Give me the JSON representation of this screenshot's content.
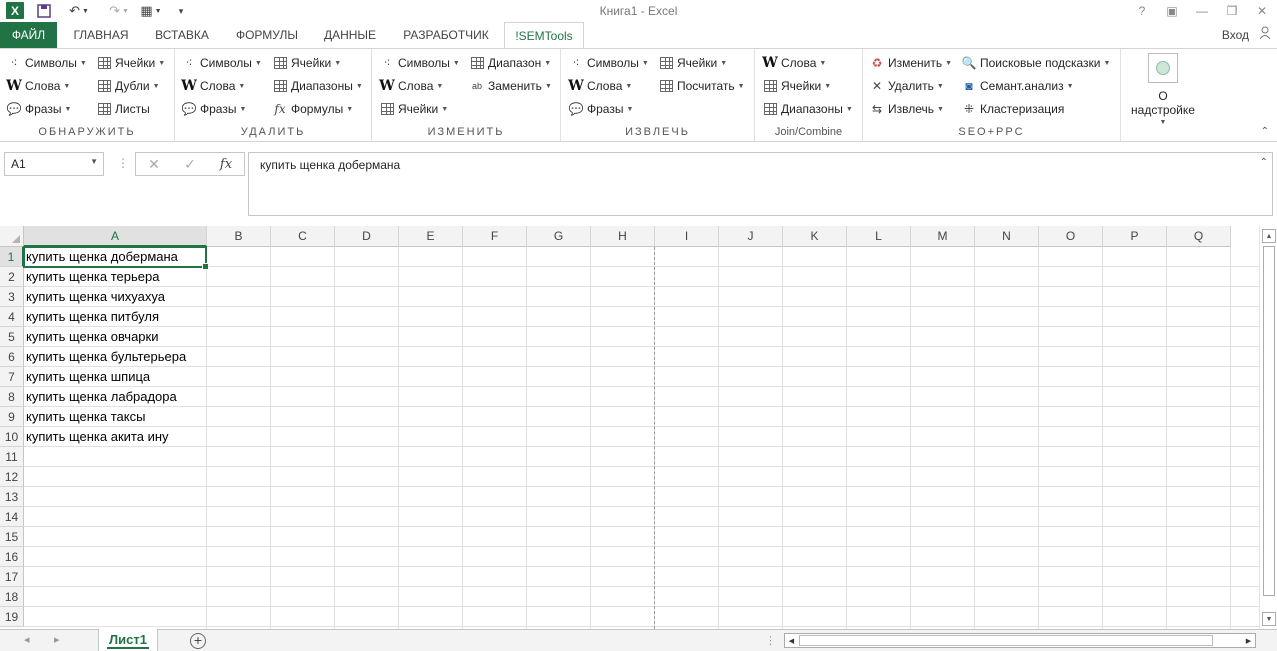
{
  "window": {
    "title": "Книга1 - Excel",
    "logo": "X"
  },
  "tabs": {
    "file": "ФАЙЛ",
    "items": [
      "ГЛАВНАЯ",
      "ВСТАВКА",
      "ФОРМУЛЫ",
      "ДАННЫЕ",
      "РАЗРАБОТЧИК",
      "!SEMTools"
    ],
    "active": "!SEMTools",
    "signin": "Вход"
  },
  "ribbon": {
    "discover": {
      "label": "ОБНАРУЖИТЬ",
      "symbols": "Символы",
      "words": "Слова",
      "phrases": "Фразы",
      "cells": "Ячейки",
      "dupes": "Дубли",
      "sheets": "Листы"
    },
    "remove": {
      "label": "УДАЛИТЬ",
      "symbols": "Символы",
      "words": "Слова",
      "phrases": "Фразы",
      "cells": "Ячейки",
      "ranges": "Диапазоны",
      "formulas": "Формулы"
    },
    "change": {
      "label": "ИЗМЕНИТЬ",
      "symbols": "Символы",
      "words": "Слова",
      "cells": "Ячейки",
      "range": "Диапазон",
      "replace": "Заменить"
    },
    "extract": {
      "label": "ИЗВЛЕЧЬ",
      "symbols": "Символы",
      "words": "Слова",
      "phrases": "Фразы",
      "cells": "Ячейки",
      "count": "Посчитать"
    },
    "join": {
      "label": "Join/Combine",
      "words": "Слова",
      "cells": "Ячейки",
      "ranges": "Диапазоны"
    },
    "seo": {
      "label": "SEO+PPC",
      "change": "Изменить",
      "remove": "Удалить",
      "extract": "Извлечь",
      "hints": "Поисковые подсказки",
      "semantic": "Семант.анализ",
      "cluster": "Кластеризация"
    },
    "about": "О надстройке"
  },
  "formula_bar": {
    "name_box": "A1",
    "content": "купить щенка добермана"
  },
  "columns": [
    "A",
    "B",
    "C",
    "D",
    "E",
    "F",
    "G",
    "H",
    "I",
    "J",
    "K",
    "L",
    "M",
    "N",
    "O",
    "P",
    "Q"
  ],
  "rows": [
    "1",
    "2",
    "3",
    "4",
    "5",
    "6",
    "7",
    "8",
    "9",
    "10",
    "11",
    "12",
    "13",
    "14",
    "15",
    "16",
    "17",
    "18",
    "19"
  ],
  "cells_a": [
    "купить щенка добермана",
    "купить щенка терьера",
    "купить щенка чихуахуа",
    "купить щенка питбуля",
    "купить щенка овчарки",
    "купить щенка бультерьера",
    "купить щенка шпица",
    "купить щенка лабрадора",
    "купить щенка таксы",
    "купить щенка акита ину"
  ],
  "sheet": {
    "name": "Лист1"
  },
  "colors": {
    "accent": "#217346"
  }
}
